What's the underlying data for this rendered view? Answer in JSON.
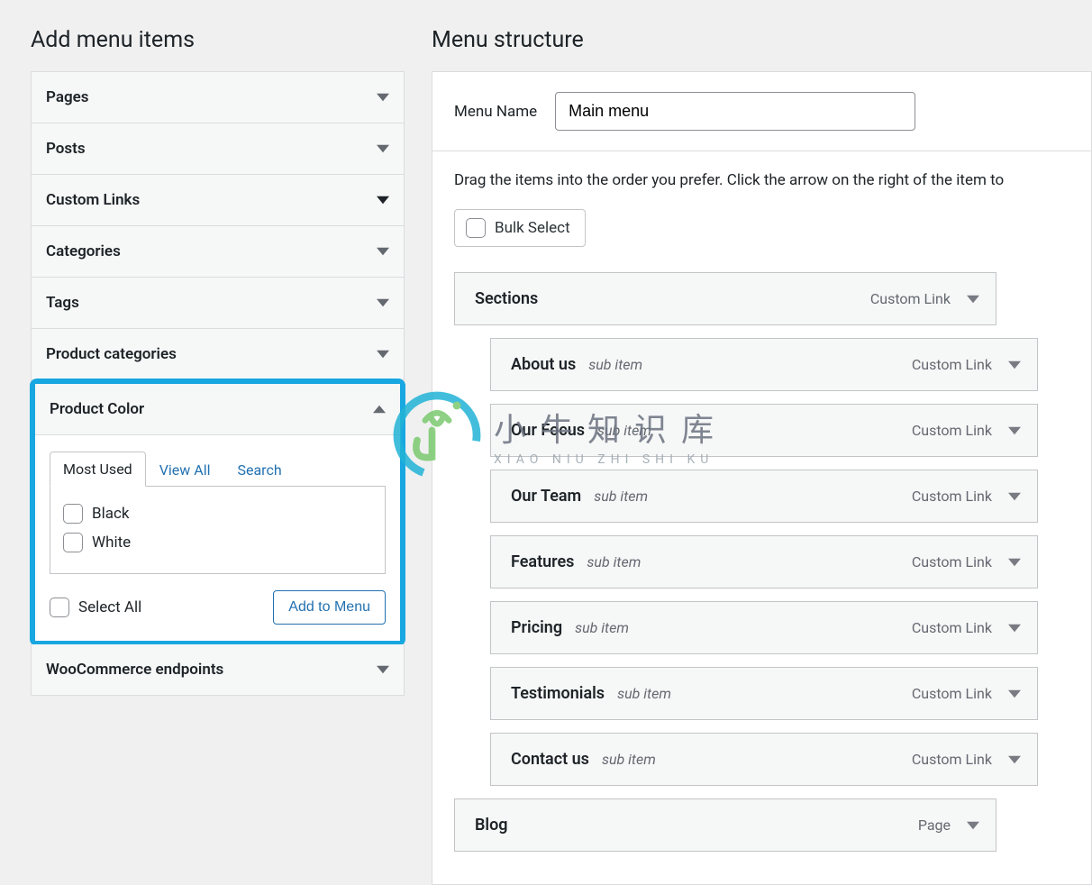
{
  "left": {
    "title": "Add menu items",
    "panels": [
      {
        "title": "Pages"
      },
      {
        "title": "Posts"
      },
      {
        "title": "Custom Links"
      },
      {
        "title": "Categories"
      },
      {
        "title": "Tags"
      },
      {
        "title": "Product categories"
      },
      {
        "title": "Product Color"
      },
      {
        "title": "WooCommerce endpoints"
      }
    ],
    "product_color": {
      "tabs": {
        "most_used": "Most Used",
        "view_all": "View All",
        "search": "Search"
      },
      "items": [
        {
          "label": "Black"
        },
        {
          "label": "White"
        }
      ],
      "select_all": "Select All",
      "add_button": "Add to Menu"
    }
  },
  "right": {
    "title": "Menu structure",
    "menu_name_label": "Menu Name",
    "menu_name_value": "Main menu",
    "instructions": "Drag the items into the order you prefer. Click the arrow on the right of the item to",
    "bulk_select": "Bulk Select",
    "items": [
      {
        "title": "Sections",
        "type": "Custom Link",
        "depth": 0
      },
      {
        "title": "About us",
        "type": "Custom Link",
        "depth": 1
      },
      {
        "title": "Our Focus",
        "type": "Custom Link",
        "depth": 1
      },
      {
        "title": "Our Team",
        "type": "Custom Link",
        "depth": 1
      },
      {
        "title": "Features",
        "type": "Custom Link",
        "depth": 1
      },
      {
        "title": "Pricing",
        "type": "Custom Link",
        "depth": 1
      },
      {
        "title": "Testimonials",
        "type": "Custom Link",
        "depth": 1
      },
      {
        "title": "Contact us",
        "type": "Custom Link",
        "depth": 1
      },
      {
        "title": "Blog",
        "type": "Page",
        "depth": 0
      }
    ],
    "sub_item_label": "sub item"
  },
  "watermark": {
    "zh": "小牛知识库",
    "py": "XIAO NIU ZHI SHI KU"
  }
}
